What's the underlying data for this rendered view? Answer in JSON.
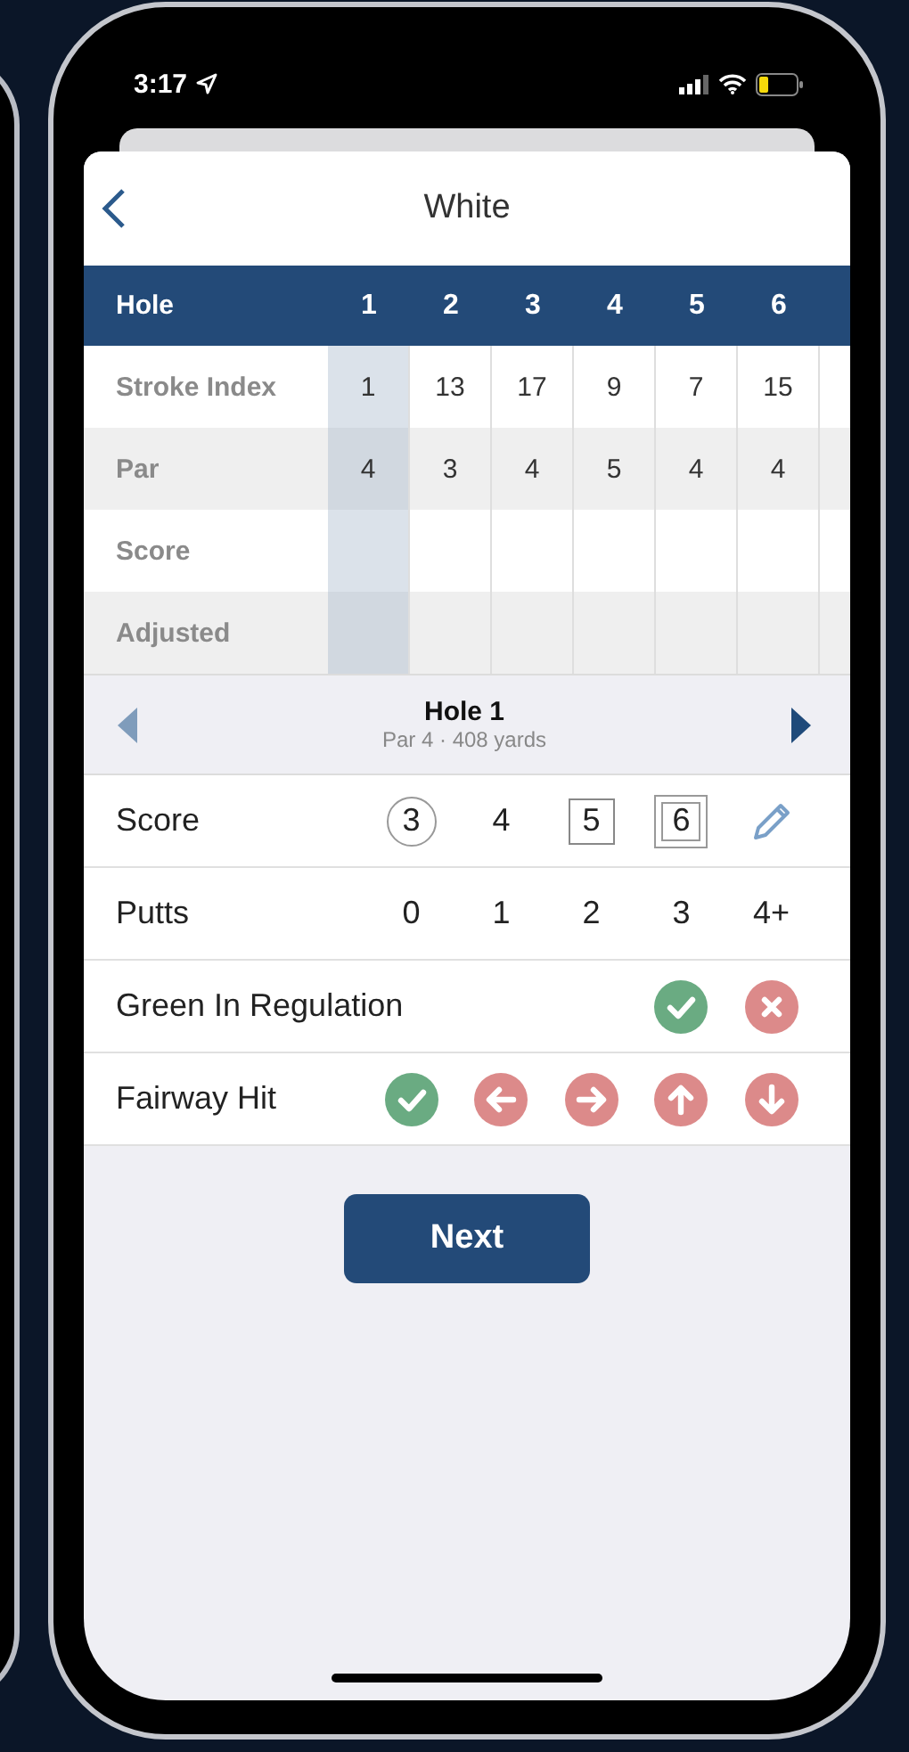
{
  "status_bar": {
    "time": "3:17"
  },
  "header": {
    "title": "White"
  },
  "scorecard": {
    "corner_label": "Hole",
    "holes": [
      {
        "label": "1",
        "selected": true
      },
      {
        "label": "2",
        "selected": false
      },
      {
        "label": "3",
        "selected": false
      },
      {
        "label": "4",
        "selected": false
      },
      {
        "label": "5",
        "selected": false
      },
      {
        "label": "6",
        "selected": false
      }
    ],
    "rows": [
      {
        "label": "Stroke Index",
        "values": [
          "1",
          "13",
          "17",
          "9",
          "7",
          "15"
        ]
      },
      {
        "label": "Par",
        "values": [
          "4",
          "3",
          "4",
          "5",
          "4",
          "4"
        ]
      },
      {
        "label": "Score",
        "values": []
      },
      {
        "label": "Adjusted",
        "values": []
      }
    ]
  },
  "hole_nav": {
    "title": "Hole 1",
    "subtitle": "Par 4 · 408 yards",
    "prev": {
      "disabled": true
    },
    "next": {
      "disabled": false
    }
  },
  "entry_rows": [
    {
      "label": "Score",
      "options": [
        {
          "kind": "circle",
          "text": "3"
        },
        {
          "kind": "plain",
          "text": "4"
        },
        {
          "kind": "square",
          "text": "5"
        },
        {
          "kind": "double-square",
          "text": "6"
        },
        {
          "kind": "pencil"
        }
      ]
    },
    {
      "label": "Putts",
      "options": [
        {
          "kind": "plain",
          "text": "0"
        },
        {
          "kind": "plain",
          "text": "1"
        },
        {
          "kind": "plain",
          "text": "2"
        },
        {
          "kind": "plain",
          "text": "3"
        },
        {
          "kind": "plain",
          "text": "4+"
        }
      ]
    },
    {
      "label": "Green In Regulation",
      "options": [
        {
          "kind": "check"
        },
        {
          "kind": "cross"
        }
      ]
    },
    {
      "label": "Fairway Hit",
      "options": [
        {
          "kind": "check"
        },
        {
          "kind": "left"
        },
        {
          "kind": "right"
        },
        {
          "kind": "up"
        },
        {
          "kind": "down"
        }
      ]
    }
  ],
  "next_button": {
    "label": "Next"
  }
}
